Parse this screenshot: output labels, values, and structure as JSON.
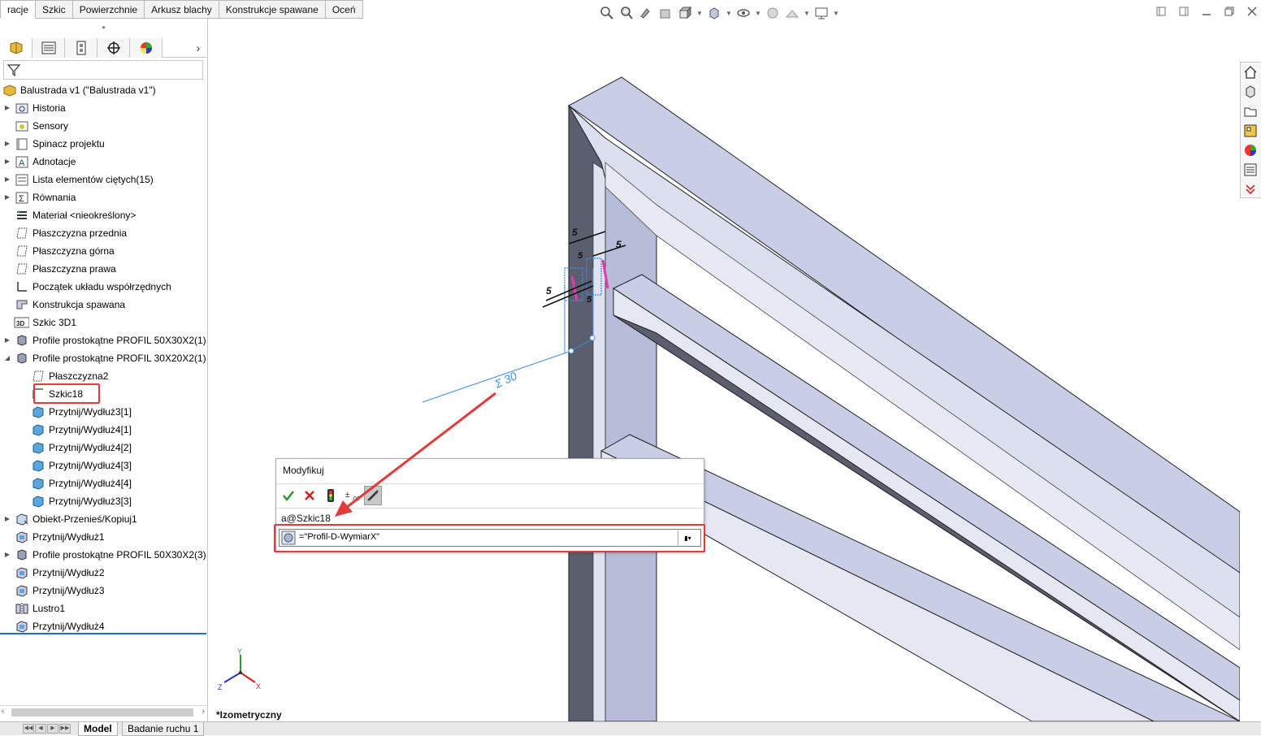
{
  "command_tabs": [
    "racje",
    "Szkic",
    "Powierzchnie",
    "Arkusz blachy",
    "Konstrukcje spawane",
    "Oceń"
  ],
  "active_tab_index": 0,
  "view_toolbar_icons": [
    "zoom-to-fit-icon",
    "zoom-to-area-icon",
    "previous-view-icon",
    "section-view-icon",
    "view-orientation-icon",
    "display-style-icon",
    "hide-show-items-icon",
    "edit-appearance-icon",
    "apply-scene-icon",
    "view-settings-icon"
  ],
  "panel_tabs": [
    "featuremanager-icon",
    "propertymanager-icon",
    "configurationmanager-icon",
    "dimxpert-icon",
    "displaymanager-icon"
  ],
  "tree": {
    "root": "Balustrada v1 (\"Balustrada v1\")",
    "items": [
      {
        "label": "Historia",
        "icon": "history-folder-icon",
        "expander": true,
        "indent": 0
      },
      {
        "label": "Sensory",
        "icon": "sensors-folder-icon",
        "expander": false,
        "indent": 0
      },
      {
        "label": "Spinacz projektu",
        "icon": "design-binder-icon",
        "expander": true,
        "indent": 0
      },
      {
        "label": "Adnotacje",
        "icon": "annotations-icon",
        "expander": true,
        "indent": 0
      },
      {
        "label": "Lista elementów ciętych(15)",
        "icon": "cut-list-icon",
        "expander": true,
        "indent": 0
      },
      {
        "label": "Równania",
        "icon": "equations-icon",
        "expander": true,
        "indent": 0
      },
      {
        "label": "Materiał <nieokreślony>",
        "icon": "material-icon",
        "expander": false,
        "indent": 0
      },
      {
        "label": "Płaszczyzna przednia",
        "icon": "plane-icon",
        "expander": false,
        "indent": 0
      },
      {
        "label": "Płaszczyzna górna",
        "icon": "plane-icon",
        "expander": false,
        "indent": 0
      },
      {
        "label": "Płaszczyzna prawa",
        "icon": "plane-icon",
        "expander": false,
        "indent": 0
      },
      {
        "label": "Początek układu współrzędnych",
        "icon": "origin-icon",
        "expander": false,
        "indent": 0
      },
      {
        "label": "Konstrukcja spawana",
        "icon": "weldment-icon",
        "expander": false,
        "indent": 0
      },
      {
        "label": "Szkic 3D1",
        "icon": "sketch-3d-icon",
        "expander": false,
        "indent": 0
      },
      {
        "label": "Profile prostokątne PROFIL 50X30X2(1)",
        "icon": "structural-member-icon",
        "expander": true,
        "indent": 0
      },
      {
        "label": "Profile prostokątne PROFIL 30X20X2(1)",
        "icon": "structural-member-icon",
        "expander": "open",
        "indent": 0
      },
      {
        "label": "Płaszczyzna2",
        "icon": "plane-icon",
        "expander": false,
        "indent": 1
      },
      {
        "label": "Szkic18",
        "icon": "sketch-icon",
        "expander": false,
        "indent": 1
      },
      {
        "label": "Przytnij/Wydłuż3[1]",
        "icon": "body-icon",
        "expander": false,
        "indent": 1
      },
      {
        "label": "Przytnij/Wydłuż4[1]",
        "icon": "body-icon",
        "expander": false,
        "indent": 1
      },
      {
        "label": "Przytnij/Wydłuż4[2]",
        "icon": "body-icon",
        "expander": false,
        "indent": 1
      },
      {
        "label": "Przytnij/Wydłuż4[3]",
        "icon": "body-icon",
        "expander": false,
        "indent": 1
      },
      {
        "label": "Przytnij/Wydłuż4[4]",
        "icon": "body-icon",
        "expander": false,
        "indent": 1
      },
      {
        "label": "Przytnij/Wydłuż3[3]",
        "icon": "body-icon",
        "expander": false,
        "indent": 1
      },
      {
        "label": "Obiekt-Przenieś/Kopiuj1",
        "icon": "move-copy-icon",
        "expander": true,
        "indent": 0
      },
      {
        "label": "Przytnij/Wydłuż1",
        "icon": "trim-extend-icon",
        "expander": false,
        "indent": 0
      },
      {
        "label": "Profile prostokątne PROFIL 50X30X2(3)",
        "icon": "structural-member-icon",
        "expander": true,
        "indent": 0
      },
      {
        "label": "Przytnij/Wydłuż2",
        "icon": "trim-extend-icon",
        "expander": false,
        "indent": 0
      },
      {
        "label": "Przytnij/Wydłuż3",
        "icon": "trim-extend-icon",
        "expander": false,
        "indent": 0
      },
      {
        "label": "Lustro1",
        "icon": "mirror-icon",
        "expander": false,
        "indent": 0
      },
      {
        "label": "Przytnij/Wydłuż4",
        "icon": "trim-extend-icon",
        "expander": false,
        "indent": 0
      }
    ]
  },
  "viewport": {
    "view_name": "*Izometryczny",
    "dimension_label": "Σ 30",
    "small_dims": [
      "5",
      "5",
      "5",
      "5",
      "5"
    ]
  },
  "modify_dialog": {
    "title": "Modyfikuj",
    "dimension_name": "a@Szkic18",
    "value": "=\"Profil-D-WymiarX\"",
    "tools": [
      "ok-check-icon",
      "cancel-x-icon",
      "rebuild-icon",
      "tolerance-icon",
      "mark-dimension-icon"
    ]
  },
  "task_pane_icons": [
    "home-icon",
    "design-library-icon",
    "file-explorer-icon",
    "view-palette-icon",
    "appearances-icon",
    "custom-properties-icon",
    "expand-icon"
  ],
  "bottom_tabs": [
    "Model",
    "Badanie ruchu 1"
  ],
  "active_bottom_tab_index": 0,
  "colors": {
    "accent": "#1f6fc8",
    "highlight_red": "#e33b3b",
    "frame_face": "#c9cde6",
    "frame_dark": "#5b5e6e"
  }
}
